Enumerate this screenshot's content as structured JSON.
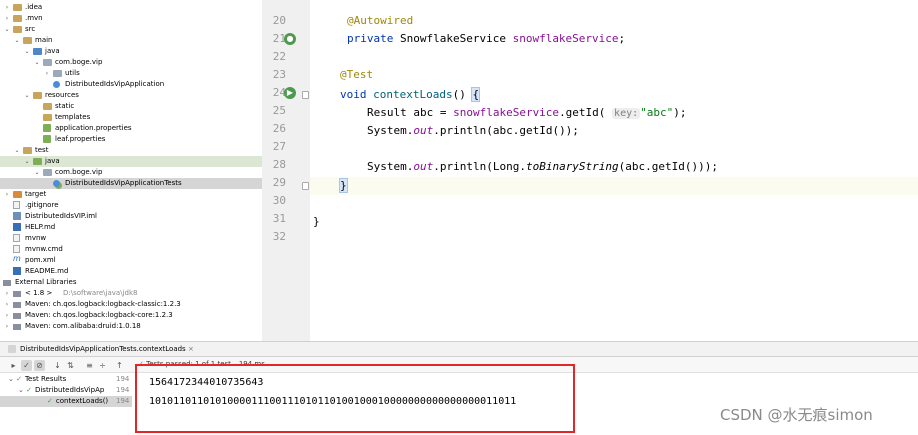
{
  "tree": [
    {
      "label": ".idea",
      "icon": "folder-icon",
      "arrow": "›",
      "indent": 0
    },
    {
      "label": ".mvn",
      "icon": "folder-icon",
      "arrow": "›",
      "indent": 0
    },
    {
      "label": "src",
      "icon": "folder-icon",
      "arrow": "⌄",
      "indent": 0
    },
    {
      "label": "main",
      "icon": "folder-icon",
      "arrow": "⌄",
      "indent": 1
    },
    {
      "label": "java",
      "icon": "source-folder-icon",
      "arrow": "⌄",
      "indent": 2
    },
    {
      "label": "com.boge.vip",
      "icon": "package-icon",
      "arrow": "⌄",
      "indent": 3
    },
    {
      "label": "utils",
      "icon": "package-icon",
      "arrow": "›",
      "indent": 4
    },
    {
      "label": "DistributedIdsVipApplication",
      "icon": "class-icon",
      "arrow": "",
      "indent": 4
    },
    {
      "label": "resources",
      "icon": "resources-folder-icon",
      "arrow": "⌄",
      "indent": 2
    },
    {
      "label": "static",
      "icon": "folder-icon",
      "arrow": "",
      "indent": 3
    },
    {
      "label": "templates",
      "icon": "folder-icon",
      "arrow": "",
      "indent": 3
    },
    {
      "label": "application.properties",
      "icon": "properties-icon",
      "arrow": "",
      "indent": 3
    },
    {
      "label": "leaf.properties",
      "icon": "properties-icon",
      "arrow": "",
      "indent": 3
    },
    {
      "label": "test",
      "icon": "folder-icon",
      "arrow": "⌄",
      "indent": 1
    },
    {
      "label": "java",
      "icon": "test-folder-icon",
      "arrow": "⌄",
      "indent": 2,
      "highlight": true
    },
    {
      "label": "com.boge.vip",
      "icon": "package-icon",
      "arrow": "⌄",
      "indent": 3
    },
    {
      "label": "DistributedIdsVipApplicationTests",
      "icon": "test-class-icon",
      "arrow": "",
      "indent": 4,
      "selected": true
    },
    {
      "label": "target",
      "icon": "target-folder-icon",
      "arrow": "›",
      "indent": 0
    },
    {
      "label": ".gitignore",
      "icon": "file-icon",
      "arrow": "",
      "indent": 0
    },
    {
      "label": "DistributedIdsVIP.iml",
      "icon": "iml-icon",
      "arrow": "",
      "indent": 0
    },
    {
      "label": "HELP.md",
      "icon": "markdown-icon",
      "arrow": "",
      "indent": 0
    },
    {
      "label": "mvnw",
      "icon": "file-icon",
      "arrow": "",
      "indent": 0
    },
    {
      "label": "mvnw.cmd",
      "icon": "file-icon",
      "arrow": "",
      "indent": 0
    },
    {
      "label": "pom.xml",
      "icon": "maven-icon",
      "arrow": "",
      "indent": 0
    },
    {
      "label": "README.md",
      "icon": "markdown-icon",
      "arrow": "",
      "indent": 0
    },
    {
      "label": "External Libraries",
      "icon": "library-icon",
      "arrow": "⌄",
      "indent": -1
    },
    {
      "label": "< 1.8 >",
      "icon": "library-icon",
      "arrow": "›",
      "indent": 0,
      "note": "D:\\software\\java\\jdk8"
    },
    {
      "label": "Maven: ch.qos.logback:logback-classic:1.2.3",
      "icon": "library-icon",
      "arrow": "›",
      "indent": 0
    },
    {
      "label": "Maven: ch.qos.logback:logback-core:1.2.3",
      "icon": "library-icon",
      "arrow": "›",
      "indent": 0
    },
    {
      "label": "Maven: com.alibaba:druid:1.0.18",
      "icon": "library-icon",
      "arrow": "›",
      "indent": 0
    }
  ],
  "editor": {
    "lines": [
      {
        "num": "20",
        "gutter": ""
      },
      {
        "num": "21",
        "gutter": "bean-icon"
      },
      {
        "num": "22",
        "gutter": ""
      },
      {
        "num": "23",
        "gutter": ""
      },
      {
        "num": "24",
        "gutter": "run-test-icon"
      },
      {
        "num": "25",
        "gutter": ""
      },
      {
        "num": "26",
        "gutter": ""
      },
      {
        "num": "27",
        "gutter": ""
      },
      {
        "num": "28",
        "gutter": ""
      },
      {
        "num": "29",
        "gutter": ""
      },
      {
        "num": "30",
        "gutter": ""
      },
      {
        "num": "31",
        "gutter": ""
      },
      {
        "num": "32",
        "gutter": ""
      }
    ],
    "code": {
      "l20_ann": "@Autowired",
      "l21_kw": "private",
      "l21_type": " SnowflakeService ",
      "l21_field": "snowflakeService",
      "l21_end": ";",
      "l23_ann": "@Test",
      "l24_kw": "void",
      "l24_name": "contextLoads",
      "l24_rest": "() ",
      "l24_brace": "{",
      "l25_a": "Result abc = ",
      "l25_field": "snowflakeService",
      "l25_b": ".getId(",
      "l25_hint": "key:",
      "l25_str": "\"abc\"",
      "l25_c": ");",
      "l26_a": "System.",
      "l26_out": "out",
      "l26_b": ".println(abc.getId());",
      "l28_a": "System.",
      "l28_out": "out",
      "l28_b": ".println(Long.",
      "l28_ital": "toBinaryString",
      "l28_c": "(abc.getId()));",
      "l29_brace": "}",
      "l31": "}"
    }
  },
  "run": {
    "tab_label": "DistributedIdsVipApplicationTests.contextLoads",
    "tab_close": "×",
    "pass_text": "Tests passed: 1 of 1 test – 194 ms",
    "tree": {
      "root_label": "Test Results",
      "root_time": "194 ms",
      "class_label": "DistributedIdsVipAp",
      "class_time": "194 ms",
      "method_label": "contextLoads()",
      "method_time": "194 ms"
    },
    "console_lines": [
      "1564172344010735643",
      "1010110110101000011100111010110100100010000000000000000011011"
    ]
  },
  "watermark": "CSDN @水无痕simon"
}
